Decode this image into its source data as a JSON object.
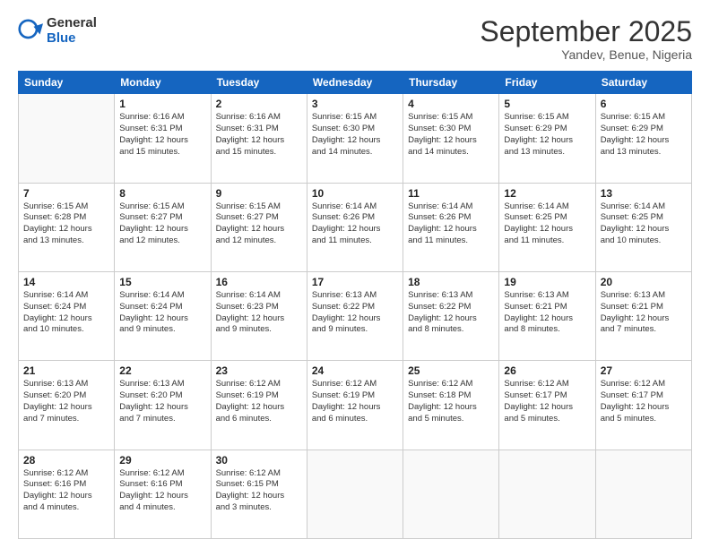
{
  "logo": {
    "general": "General",
    "blue": "Blue"
  },
  "title": "September 2025",
  "subtitle": "Yandev, Benue, Nigeria",
  "headers": [
    "Sunday",
    "Monday",
    "Tuesday",
    "Wednesday",
    "Thursday",
    "Friday",
    "Saturday"
  ],
  "weeks": [
    [
      {
        "day": "",
        "info": ""
      },
      {
        "day": "1",
        "info": "Sunrise: 6:16 AM\nSunset: 6:31 PM\nDaylight: 12 hours\nand 15 minutes."
      },
      {
        "day": "2",
        "info": "Sunrise: 6:16 AM\nSunset: 6:31 PM\nDaylight: 12 hours\nand 15 minutes."
      },
      {
        "day": "3",
        "info": "Sunrise: 6:15 AM\nSunset: 6:30 PM\nDaylight: 12 hours\nand 14 minutes."
      },
      {
        "day": "4",
        "info": "Sunrise: 6:15 AM\nSunset: 6:30 PM\nDaylight: 12 hours\nand 14 minutes."
      },
      {
        "day": "5",
        "info": "Sunrise: 6:15 AM\nSunset: 6:29 PM\nDaylight: 12 hours\nand 13 minutes."
      },
      {
        "day": "6",
        "info": "Sunrise: 6:15 AM\nSunset: 6:29 PM\nDaylight: 12 hours\nand 13 minutes."
      }
    ],
    [
      {
        "day": "7",
        "info": "Sunrise: 6:15 AM\nSunset: 6:28 PM\nDaylight: 12 hours\nand 13 minutes."
      },
      {
        "day": "8",
        "info": "Sunrise: 6:15 AM\nSunset: 6:27 PM\nDaylight: 12 hours\nand 12 minutes."
      },
      {
        "day": "9",
        "info": "Sunrise: 6:15 AM\nSunset: 6:27 PM\nDaylight: 12 hours\nand 12 minutes."
      },
      {
        "day": "10",
        "info": "Sunrise: 6:14 AM\nSunset: 6:26 PM\nDaylight: 12 hours\nand 11 minutes."
      },
      {
        "day": "11",
        "info": "Sunrise: 6:14 AM\nSunset: 6:26 PM\nDaylight: 12 hours\nand 11 minutes."
      },
      {
        "day": "12",
        "info": "Sunrise: 6:14 AM\nSunset: 6:25 PM\nDaylight: 12 hours\nand 11 minutes."
      },
      {
        "day": "13",
        "info": "Sunrise: 6:14 AM\nSunset: 6:25 PM\nDaylight: 12 hours\nand 10 minutes."
      }
    ],
    [
      {
        "day": "14",
        "info": "Sunrise: 6:14 AM\nSunset: 6:24 PM\nDaylight: 12 hours\nand 10 minutes."
      },
      {
        "day": "15",
        "info": "Sunrise: 6:14 AM\nSunset: 6:24 PM\nDaylight: 12 hours\nand 9 minutes."
      },
      {
        "day": "16",
        "info": "Sunrise: 6:14 AM\nSunset: 6:23 PM\nDaylight: 12 hours\nand 9 minutes."
      },
      {
        "day": "17",
        "info": "Sunrise: 6:13 AM\nSunset: 6:22 PM\nDaylight: 12 hours\nand 9 minutes."
      },
      {
        "day": "18",
        "info": "Sunrise: 6:13 AM\nSunset: 6:22 PM\nDaylight: 12 hours\nand 8 minutes."
      },
      {
        "day": "19",
        "info": "Sunrise: 6:13 AM\nSunset: 6:21 PM\nDaylight: 12 hours\nand 8 minutes."
      },
      {
        "day": "20",
        "info": "Sunrise: 6:13 AM\nSunset: 6:21 PM\nDaylight: 12 hours\nand 7 minutes."
      }
    ],
    [
      {
        "day": "21",
        "info": "Sunrise: 6:13 AM\nSunset: 6:20 PM\nDaylight: 12 hours\nand 7 minutes."
      },
      {
        "day": "22",
        "info": "Sunrise: 6:13 AM\nSunset: 6:20 PM\nDaylight: 12 hours\nand 7 minutes."
      },
      {
        "day": "23",
        "info": "Sunrise: 6:12 AM\nSunset: 6:19 PM\nDaylight: 12 hours\nand 6 minutes."
      },
      {
        "day": "24",
        "info": "Sunrise: 6:12 AM\nSunset: 6:19 PM\nDaylight: 12 hours\nand 6 minutes."
      },
      {
        "day": "25",
        "info": "Sunrise: 6:12 AM\nSunset: 6:18 PM\nDaylight: 12 hours\nand 5 minutes."
      },
      {
        "day": "26",
        "info": "Sunrise: 6:12 AM\nSunset: 6:17 PM\nDaylight: 12 hours\nand 5 minutes."
      },
      {
        "day": "27",
        "info": "Sunrise: 6:12 AM\nSunset: 6:17 PM\nDaylight: 12 hours\nand 5 minutes."
      }
    ],
    [
      {
        "day": "28",
        "info": "Sunrise: 6:12 AM\nSunset: 6:16 PM\nDaylight: 12 hours\nand 4 minutes."
      },
      {
        "day": "29",
        "info": "Sunrise: 6:12 AM\nSunset: 6:16 PM\nDaylight: 12 hours\nand 4 minutes."
      },
      {
        "day": "30",
        "info": "Sunrise: 6:12 AM\nSunset: 6:15 PM\nDaylight: 12 hours\nand 3 minutes."
      },
      {
        "day": "",
        "info": ""
      },
      {
        "day": "",
        "info": ""
      },
      {
        "day": "",
        "info": ""
      },
      {
        "day": "",
        "info": ""
      }
    ]
  ]
}
